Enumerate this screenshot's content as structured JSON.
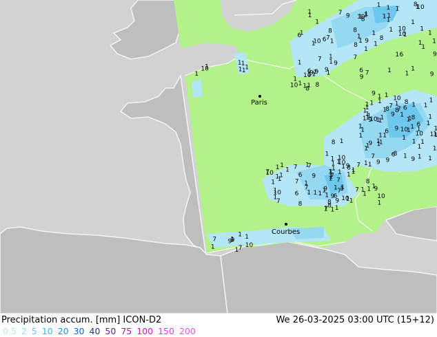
{
  "map": {
    "cities": [
      {
        "name": "Paris"
      },
      {
        "name": "Courbes"
      }
    ],
    "station_values_text": "1 2 3 4 5 6 7 8 9 10 11 12 13 15"
  },
  "footer": {
    "title": "Precipitation accum. [mm]  ICON-D2",
    "timestamp": "We 26-03-2025 03:00 UTC (15+12)"
  },
  "legend": {
    "items": [
      {
        "label": "0.5",
        "color": "#b5e6f5"
      },
      {
        "label": "2",
        "color": "#95d8f2"
      },
      {
        "label": "5",
        "color": "#6ec8ee"
      },
      {
        "label": "10",
        "color": "#3fb2e8"
      },
      {
        "label": "20",
        "color": "#1e90dc"
      },
      {
        "label": "30",
        "color": "#1463be"
      },
      {
        "label": "40",
        "color": "#2030a0"
      },
      {
        "label": "50",
        "color": "#6a1c9c"
      },
      {
        "label": "75",
        "color": "#a21cb0"
      },
      {
        "label": "100",
        "color": "#d21ccc"
      },
      {
        "label": "150",
        "color": "#e03ce0"
      },
      {
        "label": "200",
        "color": "#e85ae8"
      }
    ]
  },
  "colors": {
    "sea": "#d2d2d2",
    "land_outside": "#bebebe",
    "model_domain": "#b3f28a",
    "coast": "#f4f4f4"
  }
}
